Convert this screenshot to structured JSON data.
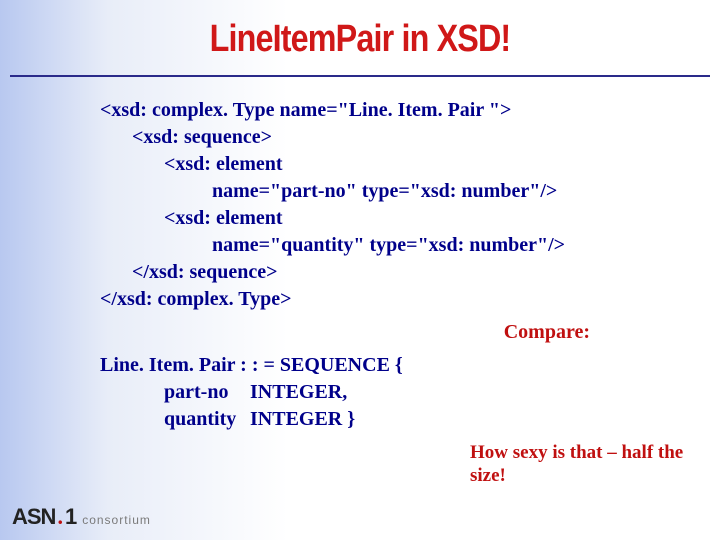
{
  "title": "LineItemPair in XSD!",
  "xsd": {
    "l1": "<xsd: complex. Type  name=\"Line. Item. Pair \">",
    "l2": "<xsd: sequence>",
    "l3": "<xsd: element",
    "l4": "name=\"part-no\"  type=\"xsd: number\"/>",
    "l5": "<xsd: element",
    "l6": "name=\"quantity\" type=\"xsd: number\"/>",
    "l7": "</xsd: sequence>",
    "l8": "</xsd: complex. Type>"
  },
  "compare_label": "Compare:",
  "asn": {
    "l1": "Line. Item. Pair  : : = SEQUENCE {",
    "r2a": "part-no",
    "r2b": "INTEGER,",
    "r3a": "quantity",
    "r3b": "INTEGER }"
  },
  "comment": "How sexy is that – half the size!",
  "footer": {
    "brand": "ASN",
    "dot": ".",
    "one": "1",
    "tag": "consortium"
  }
}
